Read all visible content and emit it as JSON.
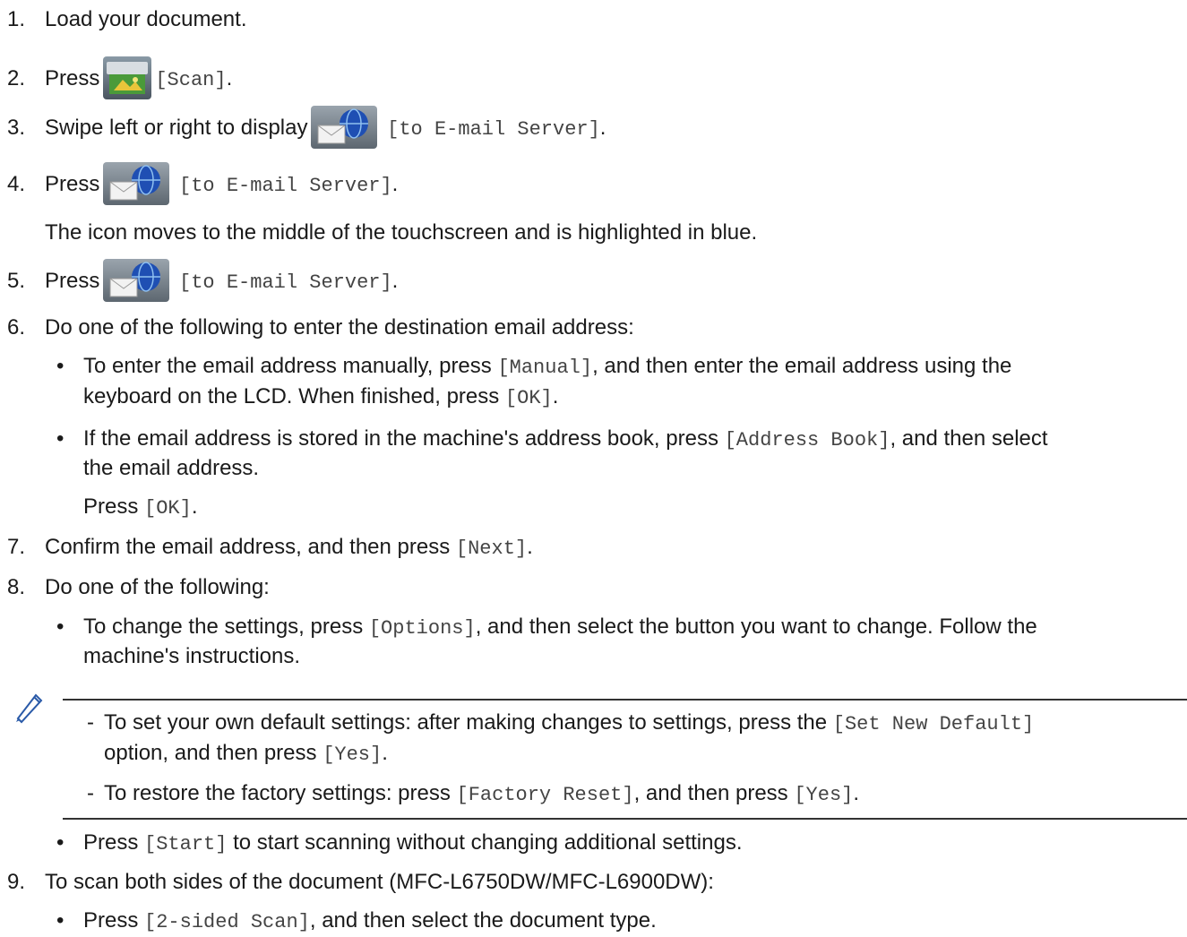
{
  "steps": [
    {
      "num": "1.",
      "parts": [
        "Load your document."
      ]
    },
    {
      "num": "2.",
      "press": "Press",
      "code": "[Scan]",
      "tail": "."
    },
    {
      "num": "3.",
      "press": "Swipe left or right to display",
      "code": "[to E-mail Server]",
      "tail": "."
    },
    {
      "num": "4.",
      "press": "Press",
      "code": "[to E-mail Server]",
      "tail": ".",
      "note": "The icon moves to the middle of the touchscreen and is highlighted in blue."
    },
    {
      "num": "5.",
      "press": "Press",
      "code": "[to E-mail Server]",
      "tail": "."
    },
    {
      "num": "6.",
      "text": "Do one of the following to enter the destination email address:"
    },
    {
      "num": "7.",
      "text_a": "Confirm the email address, and then press",
      "code": "[Next]",
      "tail": "."
    },
    {
      "num": "8.",
      "text": "Do one of the following:"
    },
    {
      "num": "9.",
      "text": "To scan both sides of the document (MFC-L6750DW/MFC-L6900DW):"
    }
  ],
  "step6": {
    "b1_a": "To enter the email address manually, press",
    "b1_code": "[Manual]",
    "b1_b": ", and then enter the email address using the",
    "b1_line2_a": "keyboard on the LCD. When finished, press",
    "b1_line2_code": "[OK]",
    "b1_line2_tail": ".",
    "b2_a": "If the email address is stored in the machine's address book, press",
    "b2_code": "[Address Book]",
    "b2_b": ", and then select",
    "b2_line2": "the email address.",
    "b2_press": "Press",
    "b2_press_code": "[OK]",
    "b2_press_tail": "."
  },
  "step8": {
    "b1_a": "To change the settings, press",
    "b1_code": "[Options]",
    "b1_b": ", and then select the button you want to change. Follow the",
    "b1_line2": "machine's instructions.",
    "note1_a": "To set your own default settings: after making changes to settings, press the",
    "note1_code": "[Set New Default]",
    "note1_line2_a": "option, and then press",
    "note1_line2_code": "[Yes]",
    "note1_line2_tail": ".",
    "note2_a": "To restore the factory settings: press",
    "note2_code": "[Factory Reset]",
    "note2_b": ", and then press",
    "note2_code2": "[Yes]",
    "note2_tail": ".",
    "b2_a": "Press",
    "b2_code": "[Start]",
    "b2_b": "to start scanning without changing additional settings."
  },
  "step9": {
    "b1_a": "Press",
    "b1_code": "[2-sided Scan]",
    "b1_b": ", and then select the document type."
  },
  "bullet_char": "•",
  "dash_char": "-",
  "icons": {
    "scan": "scan-icon",
    "email": "email-server-icon",
    "note": "pencil-note-icon"
  }
}
